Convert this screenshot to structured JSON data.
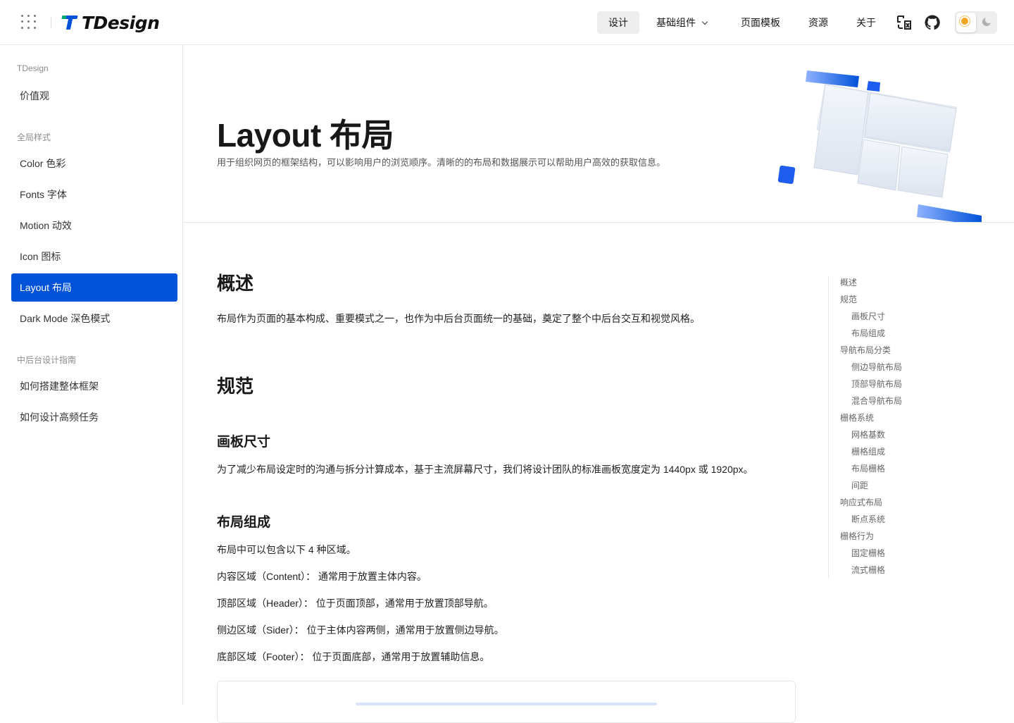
{
  "header": {
    "logo_text": "TDesign",
    "nav": [
      "设计",
      "基础组件",
      "页面模板",
      "资源",
      "关于"
    ],
    "active_nav": "设计"
  },
  "sidebar": {
    "groups": [
      {
        "title": "TDesign",
        "items": [
          "价值观"
        ]
      },
      {
        "title": "全局样式",
        "items": [
          "Color 色彩",
          "Fonts 字体",
          "Motion 动效",
          "Icon 图标",
          "Layout 布局",
          "Dark Mode 深色模式"
        ]
      },
      {
        "title": "中后台设计指南",
        "items": [
          "如何搭建整体框架",
          "如何设计高频任务"
        ]
      }
    ],
    "active_item": "Layout 布局"
  },
  "hero": {
    "title": "Layout 布局",
    "description": "用于组织网页的框架结构，可以影响用户的浏览顺序。清晰的的布局和数据展示可以帮助用户高效的获取信息。"
  },
  "content": {
    "overview_title": "概述",
    "overview_text": "布局作为页面的基本构成、重要模式之一，也作为中后台页面统一的基础，奠定了整个中后台交互和视觉风格。",
    "spec_title": "规范",
    "canvas_title": "画板尺寸",
    "canvas_text": "为了减少布局设定时的沟通与拆分计算成本，基于主流屏幕尺寸，我们将设计团队的标准画板宽度定为 1440px 或 1920px。",
    "compose_title": "布局组成",
    "compose_intro": "布局中可以包含以下 4 种区域。",
    "compose_items": [
      "内容区域（Content）：  通常用于放置主体内容。",
      "顶部区域（Header）：  位于页面顶部，通常用于放置顶部导航。",
      "侧边区域（Sider）：  位于主体内容两侧，通常用于放置侧边导航。",
      "底部区域（Footer）：  位于页面底部，通常用于放置辅助信息。"
    ]
  },
  "toc": [
    {
      "label": "概述",
      "level": 1
    },
    {
      "label": "规范",
      "level": 1
    },
    {
      "label": "画板尺寸",
      "level": 2
    },
    {
      "label": "布局组成",
      "level": 2
    },
    {
      "label": "导航布局分类",
      "level": 1
    },
    {
      "label": "侧边导航布局",
      "level": 2
    },
    {
      "label": "顶部导航布局",
      "level": 2
    },
    {
      "label": "混合导航布局",
      "level": 2
    },
    {
      "label": "栅格系统",
      "level": 1
    },
    {
      "label": "网格基数",
      "level": 2
    },
    {
      "label": "栅格组成",
      "level": 2
    },
    {
      "label": "布局栅格",
      "level": 2
    },
    {
      "label": "间距",
      "level": 2
    },
    {
      "label": "响应式布局",
      "level": 1
    },
    {
      "label": "断点系统",
      "level": 2
    },
    {
      "label": "栅格行为",
      "level": 1
    },
    {
      "label": "固定栅格",
      "level": 2
    },
    {
      "label": "流式栅格",
      "level": 2
    }
  ],
  "colors": {
    "brand": "#0052d9",
    "nav_active_bg": "#eeeeee",
    "border": "#e7e7e7"
  },
  "icons": {
    "apps": "grid-icon",
    "translate": "translate-icon",
    "github": "github-icon",
    "light": "sun-icon",
    "dark": "moon-icon",
    "dropdown": "chevron-down-icon"
  }
}
